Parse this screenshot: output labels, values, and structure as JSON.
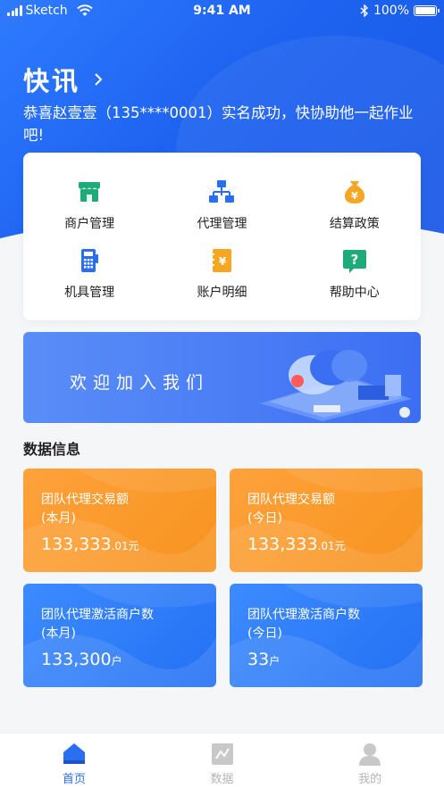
{
  "status_bar": {
    "carrier": "Sketch",
    "time": "9:41 AM",
    "battery": "100%"
  },
  "header": {
    "title": "快讯",
    "notice": "恭喜赵壹壹（135****0001）实名成功，快协助他一起作业吧!"
  },
  "menu": [
    {
      "label": "商户管理",
      "icon": "store-icon",
      "color": "#1faa7a"
    },
    {
      "label": "代理管理",
      "icon": "org-chart-icon",
      "color": "#2a6ff0"
    },
    {
      "label": "结算政策",
      "icon": "money-bag-icon",
      "color": "#f5a623"
    },
    {
      "label": "机具管理",
      "icon": "pos-terminal-icon",
      "color": "#2a6ff0"
    },
    {
      "label": "账户明细",
      "icon": "ledger-icon",
      "color": "#f5a623"
    },
    {
      "label": "帮助中心",
      "icon": "help-icon",
      "color": "#1faa7a"
    }
  ],
  "banner": {
    "text": "欢迎加入我们"
  },
  "data_section": {
    "title": "数据信息"
  },
  "stats": [
    {
      "line1": "团队代理交易额",
      "line2": "(本月)",
      "value": "133,333",
      "unit": ".01元",
      "color": "orange"
    },
    {
      "line1": "团队代理交易额",
      "line2": "(今日)",
      "value": "133,333",
      "unit": ".01元",
      "color": "orange"
    },
    {
      "line1": "团队代理激活商户数",
      "line2": "(本月)",
      "value": "133,300",
      "unit": "户",
      "color": "blue"
    },
    {
      "line1": "团队代理激活商户数",
      "line2": "(今日)",
      "value": "33",
      "unit": "户",
      "color": "blue"
    }
  ],
  "tabbar": [
    {
      "label": "首页",
      "icon": "home-icon",
      "active": true
    },
    {
      "label": "数据",
      "icon": "chart-icon",
      "active": false
    },
    {
      "label": "我的",
      "icon": "profile-icon",
      "active": false
    }
  ],
  "colors": {
    "primary": "#2a6ff0",
    "orange": "#f7931e",
    "green": "#1faa7a"
  }
}
